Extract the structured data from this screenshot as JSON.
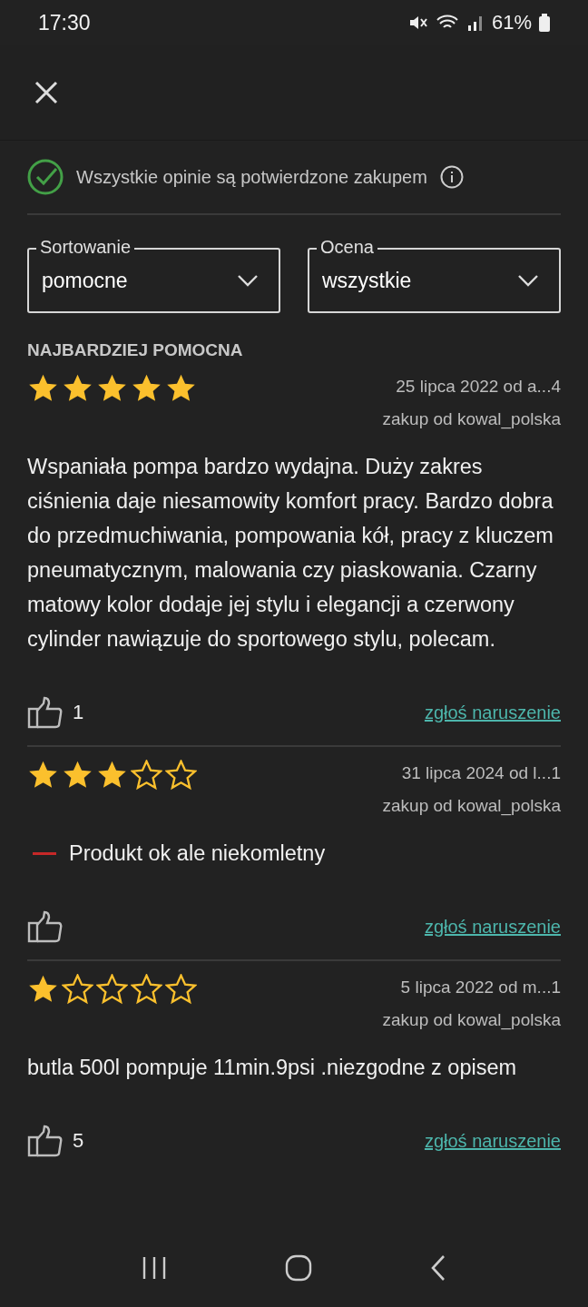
{
  "status_bar": {
    "time": "17:30",
    "battery": "61%"
  },
  "verified_note": {
    "text": "Wszystkie opinie są potwierdzone zakupem"
  },
  "filters": [
    {
      "label": "Sortowanie",
      "value": "pomocne"
    },
    {
      "label": "Ocena",
      "value": "wszystkie"
    }
  ],
  "section_title": "NAJBARDZIEJ POMOCNA",
  "reviews": [
    {
      "stars": 5,
      "date": "25 lipca 2022 od a...4",
      "purchase": "zakup od kowal_polska",
      "kind": "text",
      "body": "Wspaniała pompa bardzo wydajna. Duży zakres ciśnienia daje niesamowity komfort pracy. Bardzo dobra do przedmuchiwania, pompowania kół, pracy z kluczem pneumatycznym, malowania czy piaskowania. Czarny matowy kolor dodaje jej stylu i elegancji a czerwony cylinder nawiązuje do sportowego stylu, polecam.",
      "likes": "1",
      "report": "zgłoś naruszenie"
    },
    {
      "stars": 3,
      "date": "31 lipca 2024 od l...1",
      "purchase": "zakup od kowal_polska",
      "kind": "con",
      "body": "Produkt ok ale niekomletny",
      "report": "zgłoś naruszenie"
    },
    {
      "stars": 1,
      "date": "5 lipca 2022 od m...1",
      "purchase": "zakup od kowal_polska",
      "kind": "text",
      "body": "butla 500l pompuje 11min.9psi .niezgodne z opisem",
      "likes": "5",
      "report": "zgłoś naruszenie"
    }
  ]
}
